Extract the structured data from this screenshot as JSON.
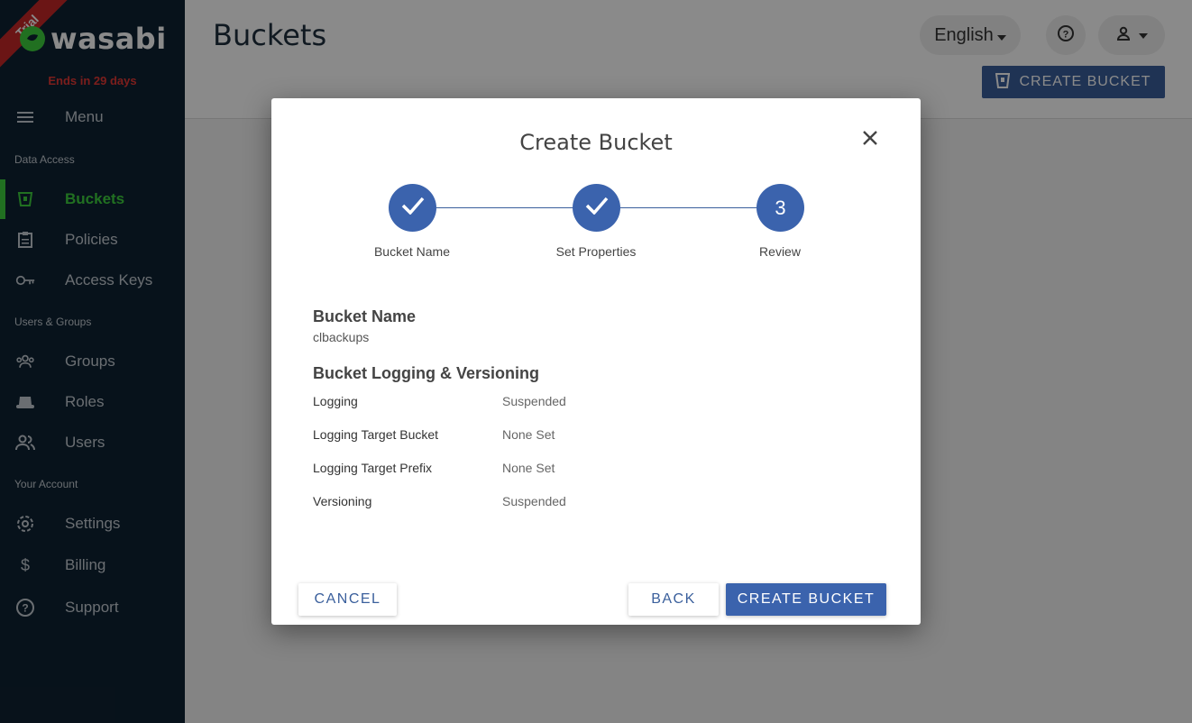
{
  "sidebar": {
    "trial_ribbon": "Trial",
    "logo_text": "wasabi",
    "trial_ends": "Ends in 29 days",
    "menu_label": "Menu",
    "sections": {
      "data_access": "Data Access",
      "users_groups": "Users & Groups",
      "your_account": "Your Account"
    },
    "items": [
      {
        "label": "Buckets",
        "icon": "bucket-icon",
        "active": true
      },
      {
        "label": "Policies",
        "icon": "clipboard-icon"
      },
      {
        "label": "Access Keys",
        "icon": "key-icon"
      },
      {
        "label": "Groups",
        "icon": "groups-icon"
      },
      {
        "label": "Roles",
        "icon": "hat-icon"
      },
      {
        "label": "Users",
        "icon": "users-icon"
      },
      {
        "label": "Settings",
        "icon": "gear-icon"
      },
      {
        "label": "Billing",
        "icon": "dollar-icon"
      },
      {
        "label": "Support",
        "icon": "help-icon"
      }
    ],
    "accent_color": "#3ecf3e"
  },
  "header": {
    "title": "Buckets",
    "language": "English",
    "create_button": "CREATE BUCKET"
  },
  "modal": {
    "title": "Create Bucket",
    "steps": [
      {
        "label": "Bucket Name",
        "state": "done"
      },
      {
        "label": "Set Properties",
        "state": "done"
      },
      {
        "label": "Review",
        "state": "current",
        "number": "3"
      }
    ],
    "bucket_name_heading": "Bucket Name",
    "bucket_name_value": "clbackups",
    "logging_heading": "Bucket Logging & Versioning",
    "properties": [
      {
        "key": "Logging",
        "value": "Suspended"
      },
      {
        "key": "Logging Target Bucket",
        "value": "None Set"
      },
      {
        "key": "Logging Target Prefix",
        "value": "None Set"
      },
      {
        "key": "Versioning",
        "value": "Suspended"
      }
    ],
    "cancel_label": "CANCEL",
    "back_label": "BACK",
    "create_label": "CREATE BUCKET",
    "primary_color": "#3b63ad"
  }
}
